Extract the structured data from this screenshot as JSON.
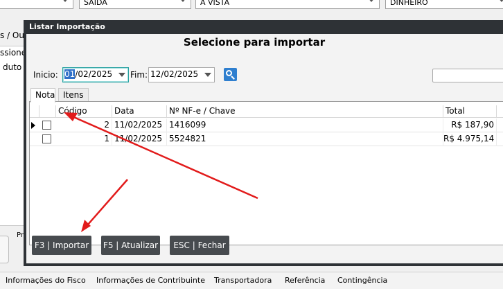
{
  "background": {
    "combos": [
      "",
      "SAÍDA",
      "À VISTA",
      "DINHEIRO"
    ],
    "tab_fragment": "s  / Ou",
    "left_label_1": "ssione",
    "left_label_2": "duto",
    "side_label": "Pr",
    "bottom_tabs": [
      "Informações do Fisco",
      "Informações de Contribuinte",
      "Transportadora",
      "Referência",
      "Contingência"
    ]
  },
  "dialog": {
    "title": "Listar Importação",
    "heading": "Selecione para importar",
    "filter": {
      "start_label": "Inicio:",
      "start_selected": "01",
      "start_rest": "/02/2025",
      "end_label": "Fim:",
      "end_value": "12/02/2025"
    },
    "tabs": [
      "Nota",
      "Itens"
    ],
    "table": {
      "columns": [
        "Código",
        "Data",
        "Nº NF-e / Chave",
        "Total"
      ],
      "rows": [
        {
          "codigo": "2",
          "data": "11/02/2025",
          "chave": "1416099",
          "total": "R$ 187,90"
        },
        {
          "codigo": "1",
          "data": "11/02/2025",
          "chave": "5524821",
          "total": "R$ 4.975,14"
        }
      ]
    },
    "buttons": {
      "import": "F3 | Importar",
      "refresh": "F5 | Atualizar",
      "close": "ESC | Fechar"
    }
  },
  "colors": {
    "dialog_frame": "#2e3236",
    "button_bg": "#474b4f",
    "annotation_arrow": "#e21b1b",
    "search_button": "#2f7fcf"
  }
}
